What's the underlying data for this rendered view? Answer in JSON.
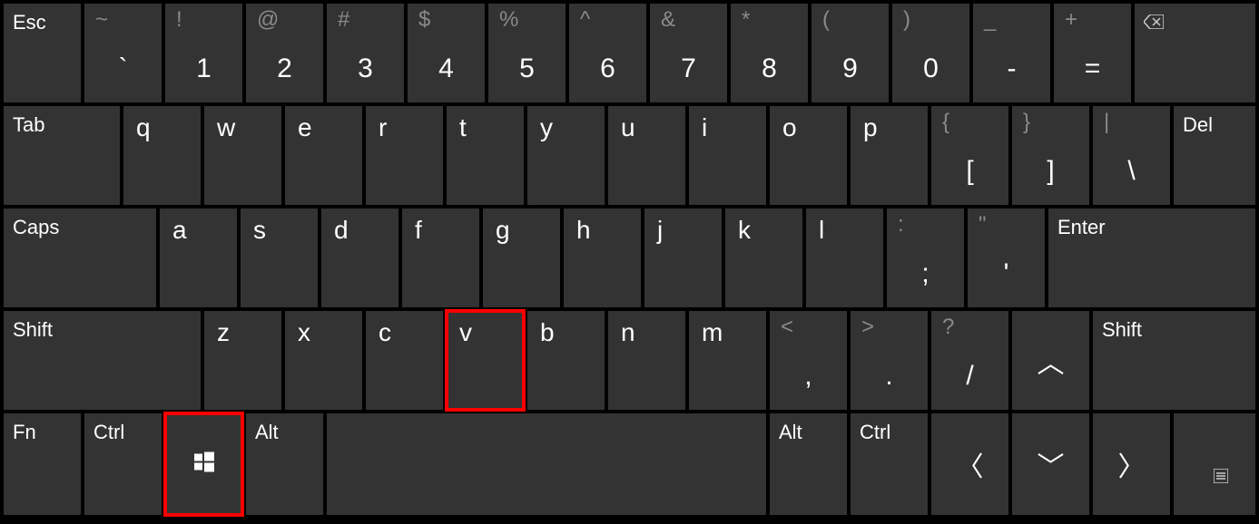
{
  "rows": {
    "r1": {
      "esc": "Esc",
      "tilde": {
        "upper": "~",
        "lower": "`"
      },
      "n1": {
        "upper": "!",
        "lower": "1"
      },
      "n2": {
        "upper": "@",
        "lower": "2"
      },
      "n3": {
        "upper": "#",
        "lower": "3"
      },
      "n4": {
        "upper": "$",
        "lower": "4"
      },
      "n5": {
        "upper": "%",
        "lower": "5"
      },
      "n6": {
        "upper": "^",
        "lower": "6"
      },
      "n7": {
        "upper": "&",
        "lower": "7"
      },
      "n8": {
        "upper": "*",
        "lower": "8"
      },
      "n9": {
        "upper": "(",
        "lower": "9"
      },
      "n0": {
        "upper": ")",
        "lower": "0"
      },
      "minus": {
        "upper": "_",
        "lower": "-"
      },
      "equals": {
        "upper": "+",
        "lower": "="
      },
      "backspace": "⌫"
    },
    "r2": {
      "tab": "Tab",
      "q": "q",
      "w": "w",
      "e": "e",
      "r": "r",
      "t": "t",
      "y": "y",
      "u": "u",
      "i": "i",
      "o": "o",
      "p": "p",
      "lbracket": {
        "upper": "{",
        "lower": "["
      },
      "rbracket": {
        "upper": "}",
        "lower": "]"
      },
      "backslash": {
        "upper": "|",
        "lower": "\\"
      },
      "del": "Del"
    },
    "r3": {
      "caps": "Caps",
      "a": "a",
      "s": "s",
      "d": "d",
      "f": "f",
      "g": "g",
      "h": "h",
      "j": "j",
      "k": "k",
      "l": "l",
      "semicolon": {
        "upper": ":",
        "lower": ";"
      },
      "quote": {
        "upper": "\"",
        "lower": "'"
      },
      "enter": "Enter"
    },
    "r4": {
      "lshift": "Shift",
      "z": "z",
      "x": "x",
      "c": "c",
      "v": "v",
      "b": "b",
      "n": "n",
      "m": "m",
      "comma": {
        "upper": "<",
        "lower": ","
      },
      "period": {
        "upper": ">",
        "lower": "."
      },
      "slash": {
        "upper": "?",
        "lower": "/"
      },
      "up": "︿",
      "rshift": "Shift"
    },
    "r5": {
      "fn": "Fn",
      "lctrl": "Ctrl",
      "win": "windows-logo-icon",
      "lalt": "Alt",
      "space": "",
      "ralt": "Alt",
      "rctrl": "Ctrl",
      "left": "〈",
      "down": "﹀",
      "right": "〉",
      "menu": "menu-icon"
    }
  },
  "highlights": [
    "v",
    "win"
  ]
}
